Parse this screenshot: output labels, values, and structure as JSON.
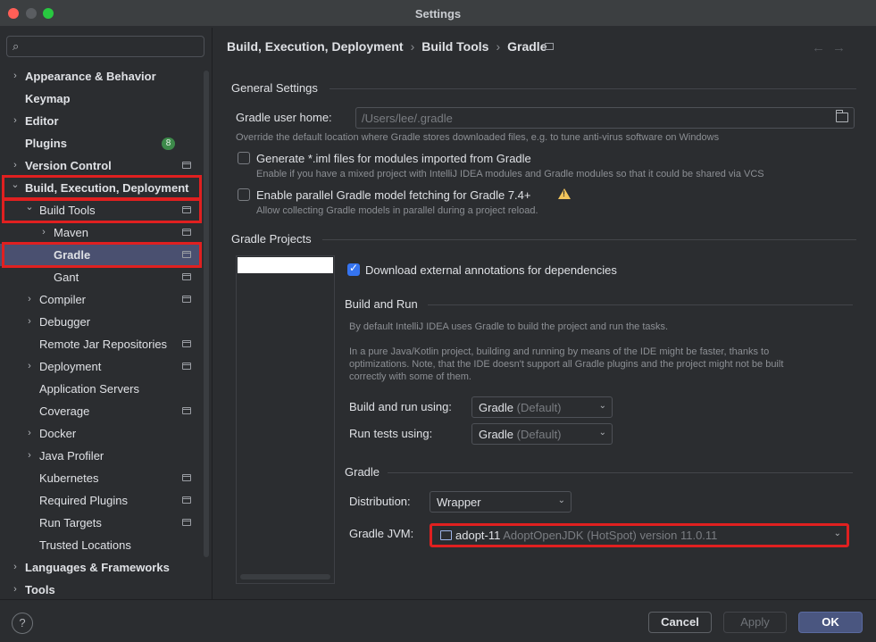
{
  "window": {
    "title": "Settings"
  },
  "search": {
    "placeholder": ""
  },
  "sidebar": {
    "items": [
      {
        "label": "Appearance & Behavior",
        "chevron": "›",
        "bold": true
      },
      {
        "label": "Keymap",
        "chevron": "",
        "bold": true
      },
      {
        "label": "Editor",
        "chevron": "›",
        "bold": true
      },
      {
        "label": "Plugins",
        "chevron": "",
        "bold": true,
        "badge": "8"
      },
      {
        "label": "Version Control",
        "chevron": "›",
        "bold": true
      },
      {
        "label": "Build, Execution, Deployment",
        "chevron": "⌄",
        "bold": true
      },
      {
        "label": "Build Tools",
        "chevron": "⌄"
      },
      {
        "label": "Maven",
        "chevron": "›"
      },
      {
        "label": "Gradle",
        "chevron": "",
        "bold": true
      },
      {
        "label": "Gant",
        "chevron": ""
      },
      {
        "label": "Compiler",
        "chevron": "›"
      },
      {
        "label": "Debugger",
        "chevron": "›"
      },
      {
        "label": "Remote Jar Repositories",
        "chevron": ""
      },
      {
        "label": "Deployment",
        "chevron": "›"
      },
      {
        "label": "Application Servers",
        "chevron": ""
      },
      {
        "label": "Coverage",
        "chevron": ""
      },
      {
        "label": "Docker",
        "chevron": "›"
      },
      {
        "label": "Java Profiler",
        "chevron": "›"
      },
      {
        "label": "Kubernetes",
        "chevron": ""
      },
      {
        "label": "Required Plugins",
        "chevron": ""
      },
      {
        "label": "Run Targets",
        "chevron": ""
      },
      {
        "label": "Trusted Locations",
        "chevron": ""
      },
      {
        "label": "Languages & Frameworks",
        "chevron": "›",
        "bold": true
      },
      {
        "label": "Tools",
        "chevron": "›",
        "bold": true
      }
    ]
  },
  "breadcrumb": {
    "part1": "Build, Execution, Deployment",
    "part2": "Build Tools",
    "part3": "Gradle",
    "sep": "›",
    "back": "←",
    "forward": "→"
  },
  "general": {
    "title": "General Settings",
    "home_label": "Gradle user home:",
    "home_placeholder": "/Users/lee/.gradle",
    "home_hint": "Override the default location where Gradle stores downloaded files, e.g. to tune anti-virus software on Windows",
    "iml_label": "Generate *.iml files for modules imported from Gradle",
    "iml_hint": "Enable if you have a mixed project with IntelliJ IDEA modules and Gradle modules so that it could be shared via VCS",
    "parallel_label": "Enable parallel Gradle model fetching for Gradle 7.4+",
    "parallel_hint": "Allow collecting Gradle models in parallel during a project reload."
  },
  "projects": {
    "title": "Gradle Projects",
    "annotations_label": "Download external annotations for dependencies",
    "build_run_title": "Build and Run",
    "build_run_hint1": "By default IntelliJ IDEA uses Gradle to build the project and run the tasks.",
    "build_run_hint2": "In a pure Java/Kotlin project, building and running by means of the IDE might be faster, thanks to",
    "build_run_hint3": "optimizations. Note, that the IDE doesn't support all Gradle plugins and the project might not be built",
    "build_run_hint4": "correctly with some of them.",
    "build_using_label": "Build and run using:",
    "build_using_value": "Gradle",
    "build_using_suffix": "(Default)",
    "tests_using_label": "Run tests using:",
    "tests_using_value": "Gradle",
    "tests_using_suffix": "(Default)",
    "gradle_title": "Gradle",
    "distribution_label": "Distribution:",
    "distribution_value": "Wrapper",
    "jvm_label": "Gradle JVM:",
    "jvm_value": "adopt-11",
    "jvm_detail": "AdoptOpenJDK (HotSpot) version 11.0.11"
  },
  "footer": {
    "help": "?",
    "cancel": "Cancel",
    "apply": "Apply",
    "ok": "OK"
  }
}
